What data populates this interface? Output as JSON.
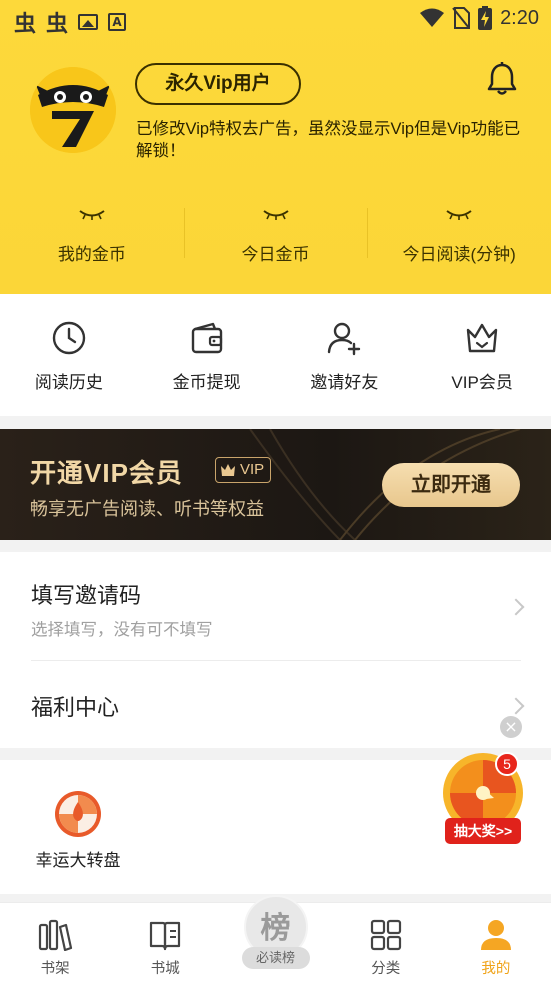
{
  "status_bar": {
    "left_glyphs": [
      "虫",
      "虫"
    ],
    "time": "2:20"
  },
  "profile": {
    "vip_badge": "永久Vip用户",
    "note": "已修改Vip特权去广告，虽然没显示Vip但是Vip功能已解锁！"
  },
  "stats": [
    {
      "label": "我的金币"
    },
    {
      "label": "今日金币"
    },
    {
      "label": "今日阅读(分钟)"
    }
  ],
  "quick_actions": [
    {
      "label": "阅读历史",
      "icon": "clock-icon"
    },
    {
      "label": "金币提现",
      "icon": "wallet-icon"
    },
    {
      "label": "邀请好友",
      "icon": "add-user-icon"
    },
    {
      "label": "VIP会员",
      "icon": "crown-icon"
    }
  ],
  "vip_banner": {
    "title": "开通VIP会员",
    "tag": "VIP",
    "subtitle": "畅享无广告阅读、听书等权益",
    "button": "立即开通"
  },
  "list": {
    "invite": {
      "title": "填写邀请码",
      "subtitle": "选择填写，没有可不填写"
    },
    "welfare": {
      "title": "福利中心"
    }
  },
  "lucky": {
    "label": "幸运大转盘"
  },
  "lottery_float": {
    "badge": "5",
    "button": "抽大奖>>"
  },
  "nav": [
    {
      "label": "书架",
      "icon": "bookshelf-icon"
    },
    {
      "label": "书城",
      "icon": "book-icon"
    },
    {
      "label": "必读榜",
      "char": "榜"
    },
    {
      "label": "分类",
      "icon": "grid-icon"
    },
    {
      "label": "我的",
      "icon": "user-icon",
      "active": true
    }
  ],
  "colors": {
    "header_yellow": "#fdd93a",
    "accent_orange": "#f0a318",
    "banner_dark": "#1c1713",
    "banner_gold": "#f1d7a6",
    "lottery_red": "#e0221b"
  }
}
